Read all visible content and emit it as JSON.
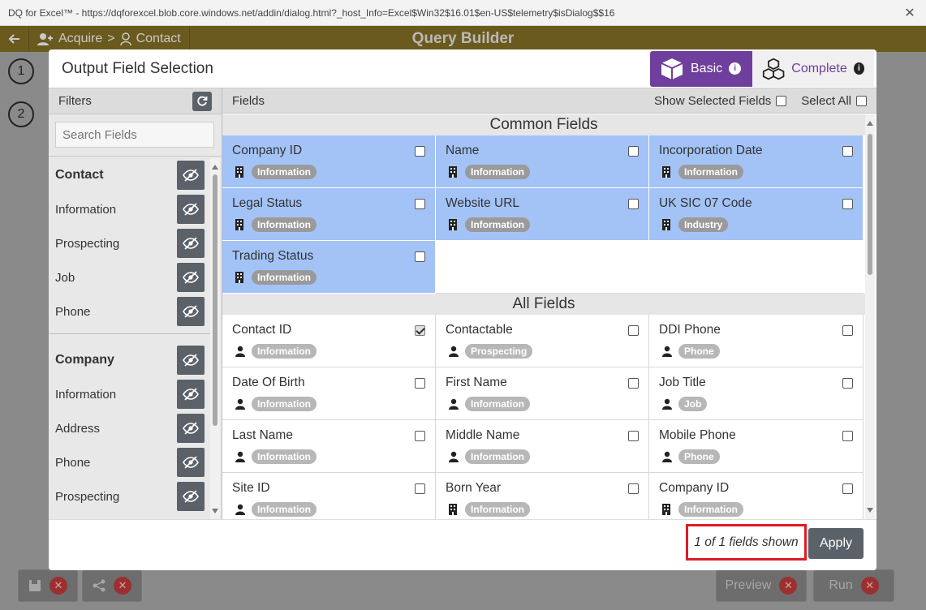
{
  "window": {
    "url": "DQ for Excel™ - https://dqforexcel.blob.core.windows.net/addin/dialog.html?_host_Info=Excel$Win32$16.01$en-US$telemetry$isDialog$$16"
  },
  "app": {
    "crumb_acquire": "Acquire",
    "crumb_sep": ">",
    "crumb_contact": "Contact",
    "title": "Query Builder",
    "steps": [
      "1",
      "2"
    ],
    "preview_label": "Preview",
    "run_label": "Run"
  },
  "modal": {
    "title": "Output Field Selection",
    "basic_label": "Basic",
    "complete_label": "Complete",
    "filters_label": "Filters",
    "search_placeholder": "Search Fields",
    "fields_label": "Fields",
    "show_selected_label": "Show Selected Fields",
    "select_all_label": "Select All",
    "fields_shown": "1 of 1 fields shown",
    "apply_label": "Apply"
  },
  "filters": [
    {
      "label": "Contact",
      "group": true
    },
    {
      "label": "Information",
      "group": false
    },
    {
      "label": "Prospecting",
      "group": false
    },
    {
      "label": "Job",
      "group": false
    },
    {
      "label": "Phone",
      "group": false
    },
    {
      "label": "Company",
      "group": true,
      "sep_before": true
    },
    {
      "label": "Information",
      "group": false
    },
    {
      "label": "Address",
      "group": false
    },
    {
      "label": "Phone",
      "group": false
    },
    {
      "label": "Prospecting",
      "group": false
    }
  ],
  "common_fields_title": "Common Fields",
  "common_fields": [
    {
      "name": "Company ID",
      "tag": "Information",
      "icon": "building-icon",
      "checked": false
    },
    {
      "name": "Name",
      "tag": "Information",
      "icon": "building-icon",
      "checked": false
    },
    {
      "name": "Incorporation Date",
      "tag": "Information",
      "icon": "building-icon",
      "checked": false
    },
    {
      "name": "Legal Status",
      "tag": "Information",
      "icon": "building-icon",
      "checked": false
    },
    {
      "name": "Website URL",
      "tag": "Information",
      "icon": "building-icon",
      "checked": false
    },
    {
      "name": "UK SIC 07 Code",
      "tag": "Industry",
      "icon": "building-icon",
      "checked": false
    },
    {
      "name": "Trading Status",
      "tag": "Information",
      "icon": "building-icon",
      "checked": false
    }
  ],
  "all_fields_title": "All Fields",
  "all_fields": [
    {
      "name": "Contact ID",
      "tag": "Information",
      "icon": "person-icon",
      "checked": true
    },
    {
      "name": "Contactable",
      "tag": "Prospecting",
      "icon": "person-icon",
      "checked": false
    },
    {
      "name": "DDI Phone",
      "tag": "Phone",
      "icon": "person-icon",
      "checked": false
    },
    {
      "name": "Date Of Birth",
      "tag": "Information",
      "icon": "person-icon",
      "checked": false
    },
    {
      "name": "First Name",
      "tag": "Information",
      "icon": "person-icon",
      "checked": false
    },
    {
      "name": "Job Title",
      "tag": "Job",
      "icon": "person-icon",
      "checked": false
    },
    {
      "name": "Last Name",
      "tag": "Information",
      "icon": "person-icon",
      "checked": false
    },
    {
      "name": "Middle Name",
      "tag": "Information",
      "icon": "person-icon",
      "checked": false
    },
    {
      "name": "Mobile Phone",
      "tag": "Phone",
      "icon": "person-icon",
      "checked": false
    },
    {
      "name": "Site ID",
      "tag": "Information",
      "icon": "person-icon",
      "checked": false
    },
    {
      "name": "Born Year",
      "tag": "Information",
      "icon": "building-icon",
      "checked": false
    },
    {
      "name": "Company ID",
      "tag": "Information",
      "icon": "building-icon",
      "checked": false
    }
  ],
  "colors": {
    "accent": "#6f3f9e",
    "highlight": "#a3c3f7",
    "button": "#5a6169",
    "annotation": "#e01b24"
  }
}
